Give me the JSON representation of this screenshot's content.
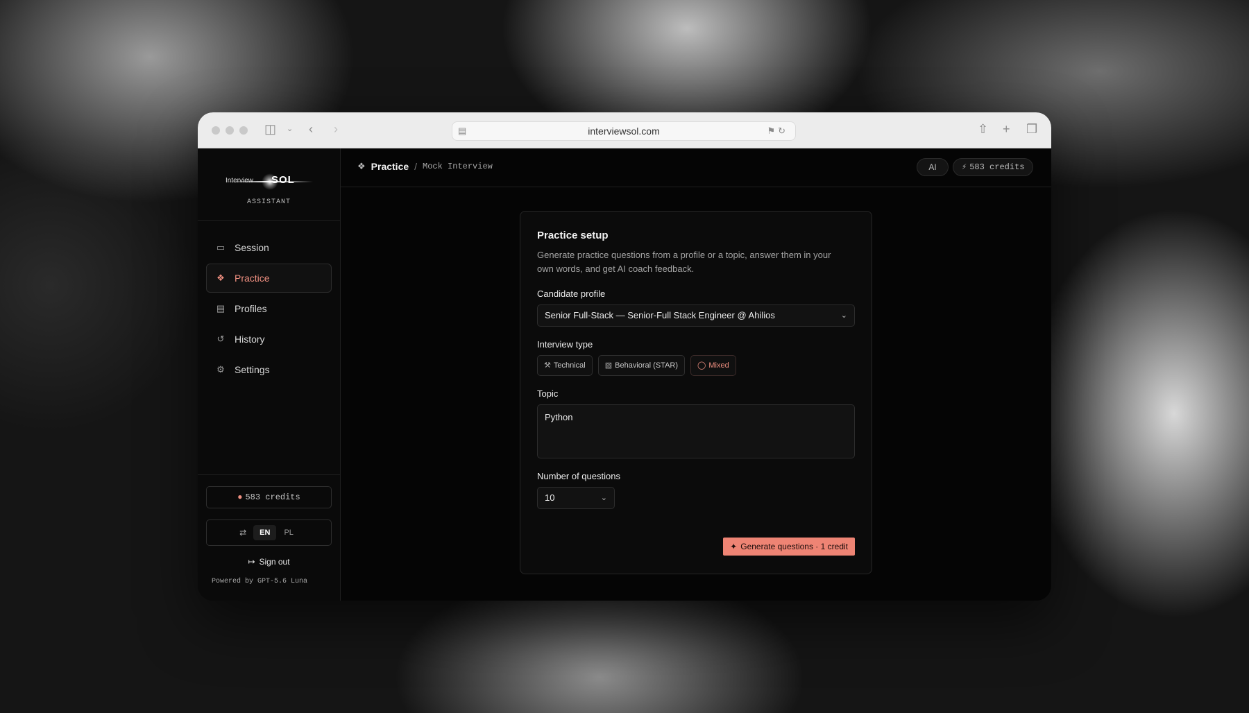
{
  "browser": {
    "url": "interviewsol.com",
    "icons": [
      "sidebar-toggle-icon",
      "chevron-down-icon",
      "back-icon",
      "forward-icon",
      "page-icon",
      "translate-icon",
      "reload-icon",
      "share-icon",
      "new-tab-icon",
      "tabs-overview-icon"
    ]
  },
  "sidebar": {
    "logo_text_small": "Interview",
    "logo_text_big": "SOL",
    "subtitle": "ASSISTANT",
    "items": [
      {
        "label": "Session",
        "icon": "monitor-icon"
      },
      {
        "label": "Practice",
        "icon": "dumbbell-icon",
        "active": true
      },
      {
        "label": "Profiles",
        "icon": "file-user-icon"
      },
      {
        "label": "History",
        "icon": "history-icon"
      },
      {
        "label": "Settings",
        "icon": "gear-icon"
      }
    ],
    "credits": "583 credits",
    "lang_en": "EN",
    "lang_pl": "PL",
    "sign_out": "Sign out",
    "powered_by": "Powered by GPT-5.6 Luna"
  },
  "topbar": {
    "crumb_current": "Practice",
    "crumb_sep": "/",
    "crumb_sub": "Mock Interview",
    "ai_label": "AI",
    "credits": "583 credits"
  },
  "card": {
    "title": "Practice setup",
    "description": "Generate practice questions from a profile or a topic, answer them in your own words, and get AI coach feedback.",
    "profile_label": "Candidate profile",
    "profile_value": "Senior Full-Stack — Senior-Full Stack Engineer @ Ahilios",
    "type_label": "Interview type",
    "types": [
      {
        "label": "Technical",
        "selected": false
      },
      {
        "label": "Behavioral (STAR)",
        "selected": false
      },
      {
        "label": "Mixed",
        "selected": true
      }
    ],
    "topic_label": "Topic",
    "topic_value": "Python",
    "num_label": "Number of questions",
    "num_value": "10",
    "generate_label": "Generate questions · 1 credit"
  },
  "colors": {
    "accent": "#ee8474",
    "panel": "#0b0b0b",
    "background": "#050505"
  }
}
